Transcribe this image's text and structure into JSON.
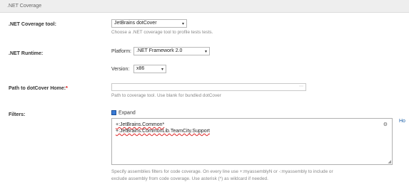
{
  "section": {
    "title": ".NET Coverage"
  },
  "coverage_tool": {
    "label": ".NET Coverage tool:",
    "value": "JetBrains dotCover",
    "hint": "Choose a .NET coverage tool to profile tests tests."
  },
  "runtime": {
    "label": ".NET Runtime:",
    "platform_label": "Platform:",
    "platform_value": ".NET Framework 2.0",
    "version_label": "Version:",
    "version_value": "x86"
  },
  "dotcover_home": {
    "label": "Path to dotCover Home:",
    "required_mark": "*",
    "value": "",
    "hint": "Path to coverage tool. Use blank for bundled dotCover"
  },
  "filters": {
    "label": "Filters:",
    "expand_label": "Expand",
    "lines": [
      "+:JetBrains.Common*",
      "+:JetBrains.CommonLib.TeamCity.Support"
    ],
    "more_link": "Ho",
    "help": "Specify assemblies filters for code coverage. On every line use +:myassemblyN or -:myassembly to include or",
    "help2": "exclude assembly from code coverage. Use asterisk (*) as wildcard if needed."
  }
}
